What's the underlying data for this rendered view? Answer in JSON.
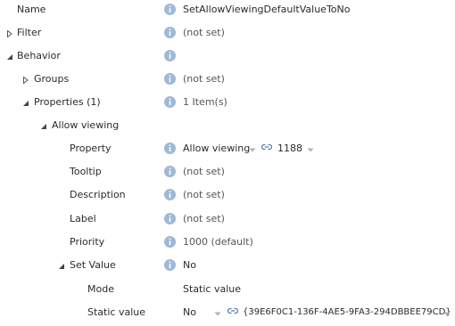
{
  "rows": {
    "name": {
      "label": "Name",
      "value": "SetAllowViewingDefaultValueToNo"
    },
    "filter": {
      "label": "Filter",
      "value": "(not set)"
    },
    "behavior": {
      "label": "Behavior"
    },
    "groups": {
      "label": "Groups",
      "value": "(not set)"
    },
    "properties": {
      "label": "Properties (1)",
      "value": "1 Item(s)"
    },
    "allow_viewing": {
      "label": "Allow viewing"
    },
    "property": {
      "label": "Property",
      "value": "Allow viewing",
      "linked_value": "1188"
    },
    "tooltip": {
      "label": "Tooltip",
      "value": "(not set)"
    },
    "description": {
      "label": "Description",
      "value": "(not set)"
    },
    "label": {
      "label": "Label",
      "value": "(not set)"
    },
    "priority": {
      "label": "Priority",
      "value": "1000 (default)"
    },
    "set_value": {
      "label": "Set Value",
      "value": "No"
    },
    "mode": {
      "label": "Mode",
      "value": "Static value"
    },
    "static_value": {
      "label": "Static value",
      "value": "No",
      "linked_value": "{39E6F0C1-136F-4AE5-9FA3-294DBBEE79CD}"
    }
  },
  "icons": {
    "info": "info-icon",
    "expand": "triangle-right-icon",
    "collapse": "triangle-down-icon",
    "link": "link-icon",
    "dropdown": "chevron-down-icon"
  },
  "colors": {
    "info_icon": "#9fb8d6",
    "text": "#2b2b2b",
    "muted": "#555555"
  }
}
